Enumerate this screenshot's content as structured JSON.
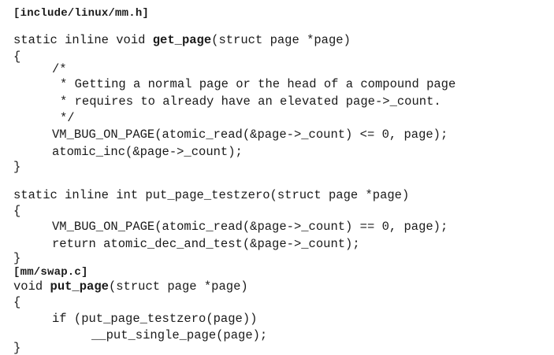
{
  "document": {
    "file_headers": [
      "[include/linux/mm.h]",
      "[mm/swap.c]"
    ],
    "get_page": {
      "signature_prefix": "static inline void ",
      "name": "get_page",
      "signature_suffix": "(struct page *page)",
      "open_brace": "{",
      "comment_open": "/*",
      "comment_line_1": "* Getting a normal page or the head of a compound page",
      "comment_line_2": "* requires to already have an elevated page->_count.",
      "comment_close": "*/",
      "stmt_1": "VM_BUG_ON_PAGE(atomic_read(&page->_count) <= 0, page);",
      "stmt_2": "atomic_inc(&page->_count);",
      "close_brace": "}"
    },
    "put_page_testzero": {
      "signature": "static inline int put_page_testzero(struct page *page)",
      "open_brace": "{",
      "stmt_1": "VM_BUG_ON_PAGE(atomic_read(&page->_count) == 0, page);",
      "stmt_2": "return atomic_dec_and_test(&page->_count);",
      "close_brace": "}"
    },
    "put_page": {
      "signature_prefix": "void ",
      "name": "put_page",
      "signature_suffix": "(struct page *page)",
      "open_brace": "{",
      "stmt_1": "if (put_page_testzero(page))",
      "stmt_2": "__put_single_page(page);",
      "close_brace": "}"
    }
  }
}
